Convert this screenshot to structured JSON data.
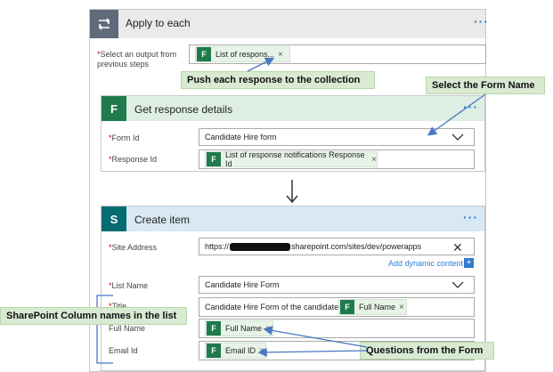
{
  "apply_to_each": {
    "title": "Apply to each",
    "select_output_label": "Select an output from previous steps",
    "token": "List of respons..."
  },
  "get_response": {
    "title": "Get response details",
    "form_id_label": "Form Id",
    "form_id_value": "Candidate Hire form",
    "response_id_label": "Response Id",
    "response_id_token": "List of response notifications Response Id"
  },
  "create_item": {
    "title": "Create item",
    "site_address_label": "Site Address",
    "site_address_prefix": "https://",
    "site_address_suffix": "sharepoint.com/sites/dev/powerapps",
    "add_dynamic": "Add dynamic content",
    "list_name_label": "List Name",
    "list_name_value": "Candidate Hire Form",
    "title_label": "Title",
    "title_text": "Candidate Hire Form of the candidate :",
    "title_token": "Full Name",
    "full_name_label": "Full Name",
    "full_name_token": "Full Name",
    "email_label": "Email Id",
    "email_token": "Email ID"
  },
  "callouts": {
    "push": "Push each response to the collection",
    "select_form": "Select the Form Name",
    "sp_columns": "SharePoint Column names in the list",
    "questions": "Questions from the Form"
  },
  "icons": {
    "forms_letter": "F",
    "sharepoint_letter": "S"
  },
  "colors": {
    "accent": "#2f7bd1",
    "forms_green": "#1f7a4c",
    "sharepoint_teal": "#036c70",
    "callout_bg": "#d9ead3",
    "required": "#cc0000"
  }
}
